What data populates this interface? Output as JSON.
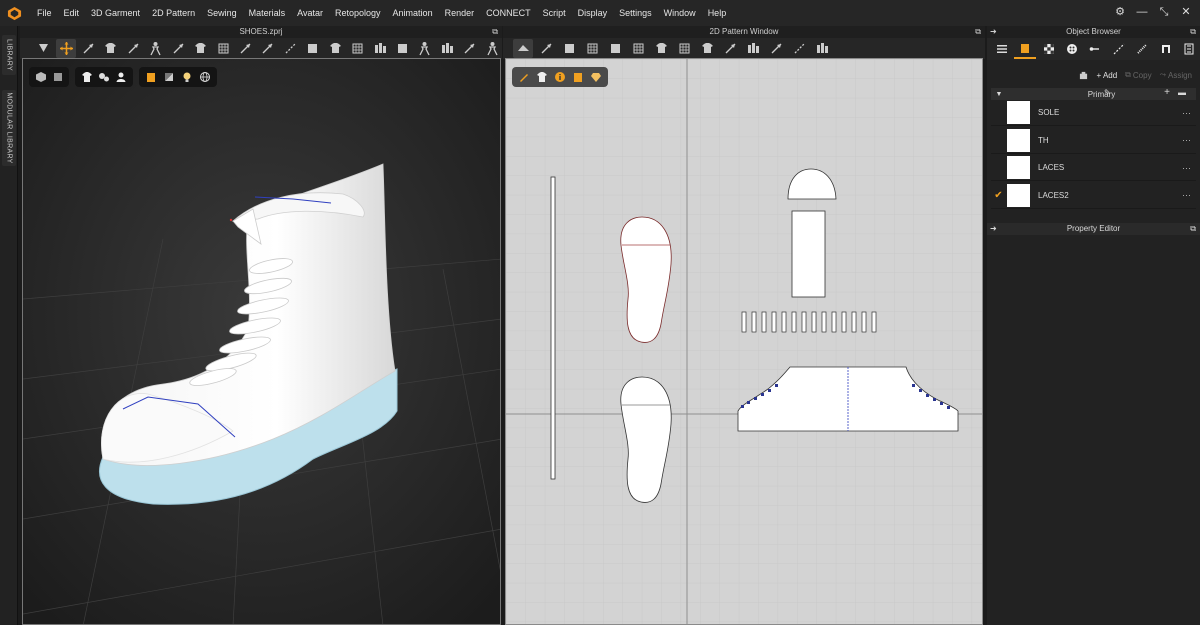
{
  "menu": [
    "File",
    "Edit",
    "3D Garment",
    "2D Pattern",
    "Sewing",
    "Materials",
    "Avatar",
    "Retopology",
    "Animation",
    "Render",
    "CONNECT",
    "Script",
    "Display",
    "Settings",
    "Window",
    "Help"
  ],
  "window_controls": [
    "gear-icon",
    "minimize-icon",
    "restore-icon",
    "close-icon"
  ],
  "left_tabs": [
    "LIBRARY",
    "MODULAR LIBRARY"
  ],
  "panel3d": {
    "title": "SHOES.zprj"
  },
  "panel2d": {
    "title": "2D Pattern Window"
  },
  "object_browser": {
    "title": "Object Browser",
    "actions": {
      "add": "+ Add",
      "copy": "Copy",
      "assign": "Assign"
    },
    "group": "Primary",
    "materials": [
      {
        "name": "SOLE",
        "checked": false
      },
      {
        "name": "TH",
        "checked": false
      },
      {
        "name": "LACES",
        "checked": false
      },
      {
        "name": "LACES2",
        "checked": true
      }
    ],
    "more": "···"
  },
  "property_editor": {
    "title": "Property Editor"
  },
  "colors": {
    "accent": "#f0a020",
    "sole": "#bfe2ee",
    "shoe": "#ffffff",
    "pattern_bg": "#d3d3d3"
  }
}
